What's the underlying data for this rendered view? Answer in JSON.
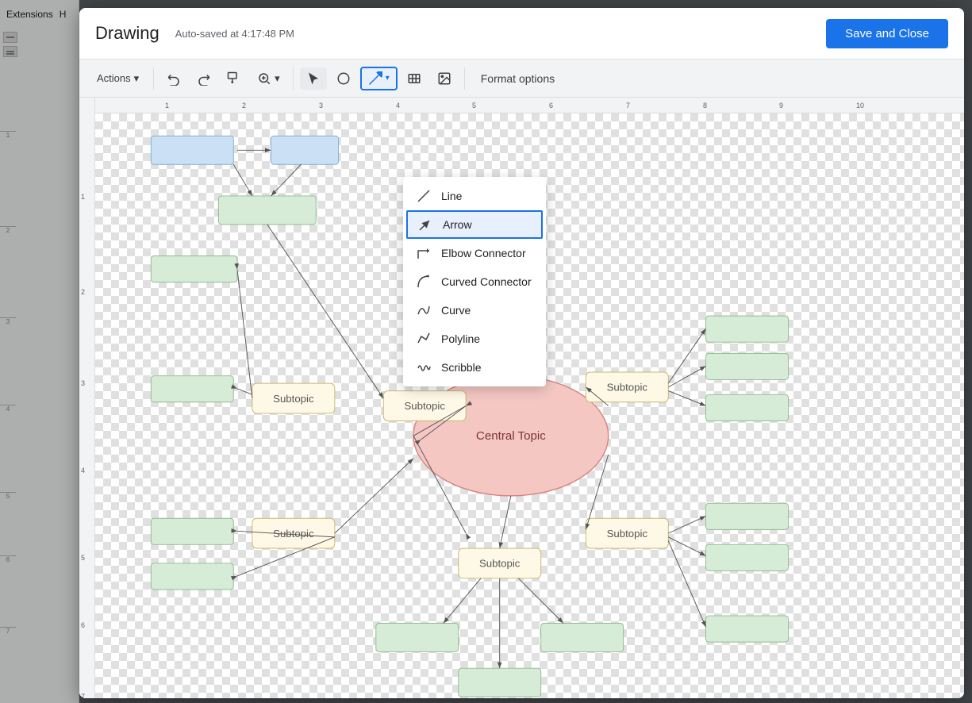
{
  "app": {
    "title": "Drawing",
    "autosave": "Auto-saved at 4:17:48 PM",
    "save_close_label": "Save and Close"
  },
  "toolbar": {
    "actions_label": "Actions",
    "actions_arrow": "▾",
    "format_options_label": "Format options"
  },
  "line_menu": {
    "items": [
      {
        "id": "line",
        "label": "Line",
        "icon": "line"
      },
      {
        "id": "arrow",
        "label": "Arrow",
        "icon": "arrow",
        "selected": true
      },
      {
        "id": "elbow",
        "label": "Elbow Connector",
        "icon": "elbow"
      },
      {
        "id": "curved",
        "label": "Curved Connector",
        "icon": "curved"
      },
      {
        "id": "curve",
        "label": "Curve",
        "icon": "curve"
      },
      {
        "id": "polyline",
        "label": "Polyline",
        "icon": "polyline"
      },
      {
        "id": "scribble",
        "label": "Scribble",
        "icon": "scribble"
      }
    ]
  },
  "diagram": {
    "central_topic": "Central Topic",
    "subtopics": [
      "Subtopic",
      "Subtopic",
      "Subtopic",
      "Subtopic"
    ]
  },
  "docs_menu": {
    "extensions": "Extensions",
    "help": "H"
  }
}
